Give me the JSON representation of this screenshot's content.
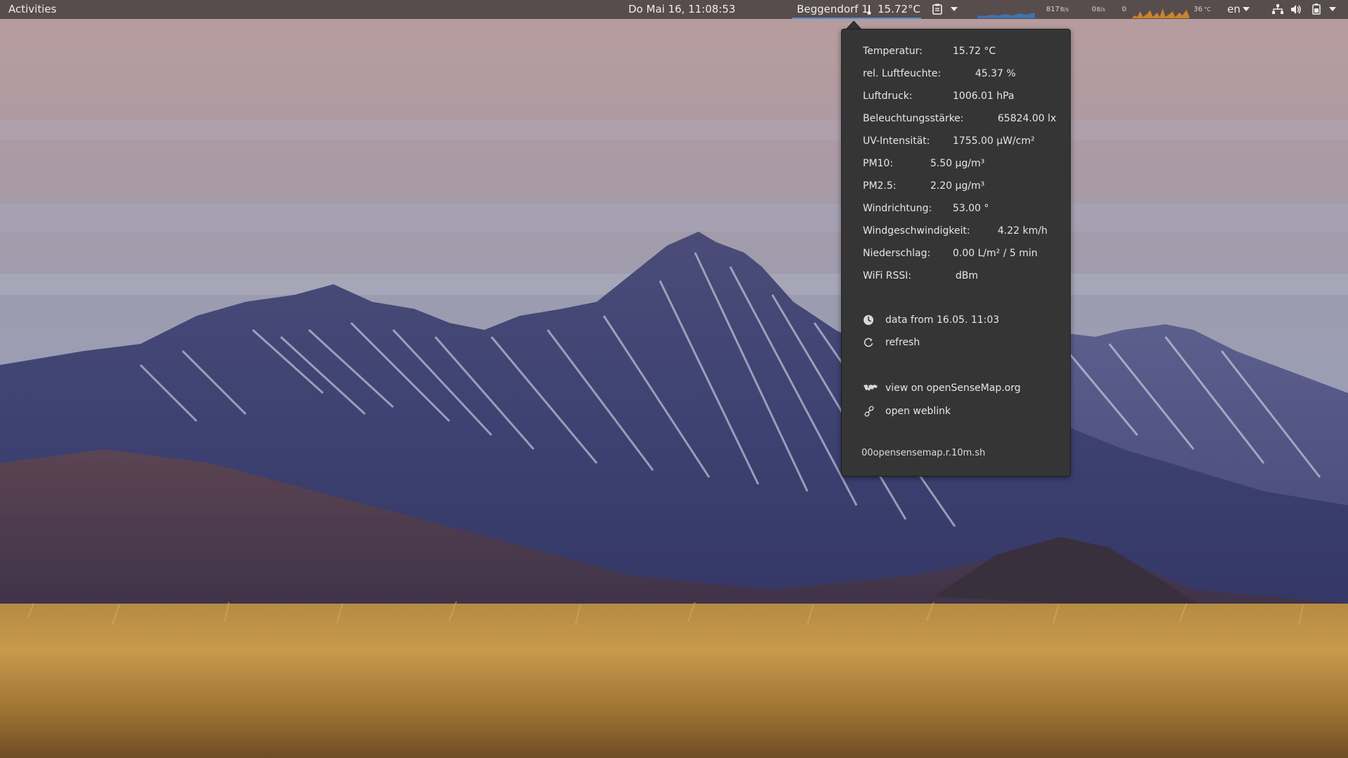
{
  "topbar": {
    "activities": "Activities",
    "clock": "Do Mai 16, 11:08:53",
    "sensebox_station": "Beggendorf 1",
    "sensebox_temp": "15.72°C",
    "lang": "en",
    "sysmon": {
      "net_speed": "817",
      "net_unit": "B/s",
      "disk": "0",
      "disk_unit": "B/s",
      "cpu_value": "0",
      "temp": "36",
      "temp_unit": "°C"
    }
  },
  "popup": {
    "readings": [
      {
        "label": "Temperatur:",
        "value": "15.72 °C"
      },
      {
        "label": "rel. Luftfeuchte:",
        "value": "45.37 %"
      },
      {
        "label": "Luftdruck:",
        "value": "1006.01 hPa"
      },
      {
        "label": "Beleuchtungsstärke:",
        "value": "65824.00 lx"
      },
      {
        "label": "UV-Intensität:",
        "value": "1755.00 μW/cm²"
      },
      {
        "label": "PM10:",
        "value": "5.50 μg/m³"
      },
      {
        "label": "PM2.5:",
        "value": "2.20 μg/m³"
      },
      {
        "label": "Windrichtung:",
        "value": "53.00 °"
      },
      {
        "label": "Windgeschwindigkeit:",
        "value": "4.22 km/h"
      },
      {
        "label": "Niederschlag:",
        "value": "0.00 L/m² / 5 min"
      },
      {
        "label": "WiFi RSSI:",
        "value": "dBm"
      }
    ],
    "data_from": "data from 16.05. 11:03",
    "refresh": "refresh",
    "view_map": "view on openSenseMap.org",
    "open_weblink": "open weblink",
    "script_name": "00opensensemap.r.10m.sh"
  },
  "icons": {
    "thermometer": "thermometer-icon",
    "clipboard": "clipboard-icon",
    "clock": "clock-icon",
    "refresh": "refresh-icon",
    "map": "globe-icon",
    "link": "link-icon",
    "network": "network-icon",
    "volume": "volume-icon",
    "battery": "battery-icon"
  }
}
